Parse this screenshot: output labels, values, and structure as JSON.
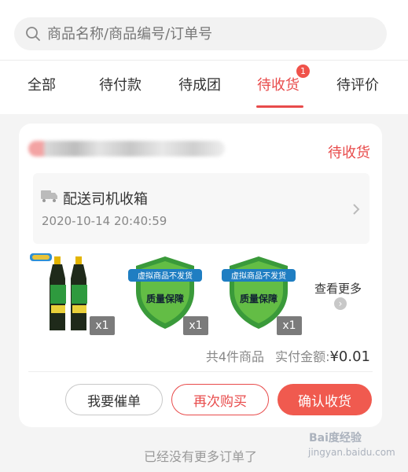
{
  "search": {
    "placeholder": "商品名称/商品编号/订单号"
  },
  "tabs": [
    {
      "label": "全部"
    },
    {
      "label": "待付款"
    },
    {
      "label": "待成团"
    },
    {
      "label": "待收货",
      "badge": "1",
      "active": true
    },
    {
      "label": "待评价"
    }
  ],
  "order": {
    "status": "待收货",
    "delivery": {
      "title": "配送司机收箱",
      "time": "2020-10-14 20:40:59",
      "icon": "truck-icon"
    },
    "items": [
      {
        "image": "soy-sauce-bottles",
        "qty": "x1"
      },
      {
        "image": "shield-badge",
        "shield_top": "虚拟商品不发货",
        "shield_main": "质量保障",
        "qty": "x1"
      },
      {
        "image": "shield-badge",
        "shield_top": "虚拟商品不发货",
        "shield_main": "质量保障",
        "qty": "x1"
      }
    ],
    "view_more": "查看更多",
    "summary": {
      "count_text": "共4件商品",
      "paid_label": "实付金额:",
      "paid_amount": "¥0.01"
    },
    "buttons": {
      "urge": "我要催单",
      "rebuy": "再次购买",
      "confirm": "确认收货"
    }
  },
  "footer": {
    "no_more": "已经没有更多订单了"
  },
  "watermark": {
    "brand": "Bai度经验",
    "url": "jingyan.baidu.com"
  },
  "colors": {
    "accent": "#e84b4b",
    "confirm": "#f05a4f",
    "shield": "#3a9a3a"
  }
}
